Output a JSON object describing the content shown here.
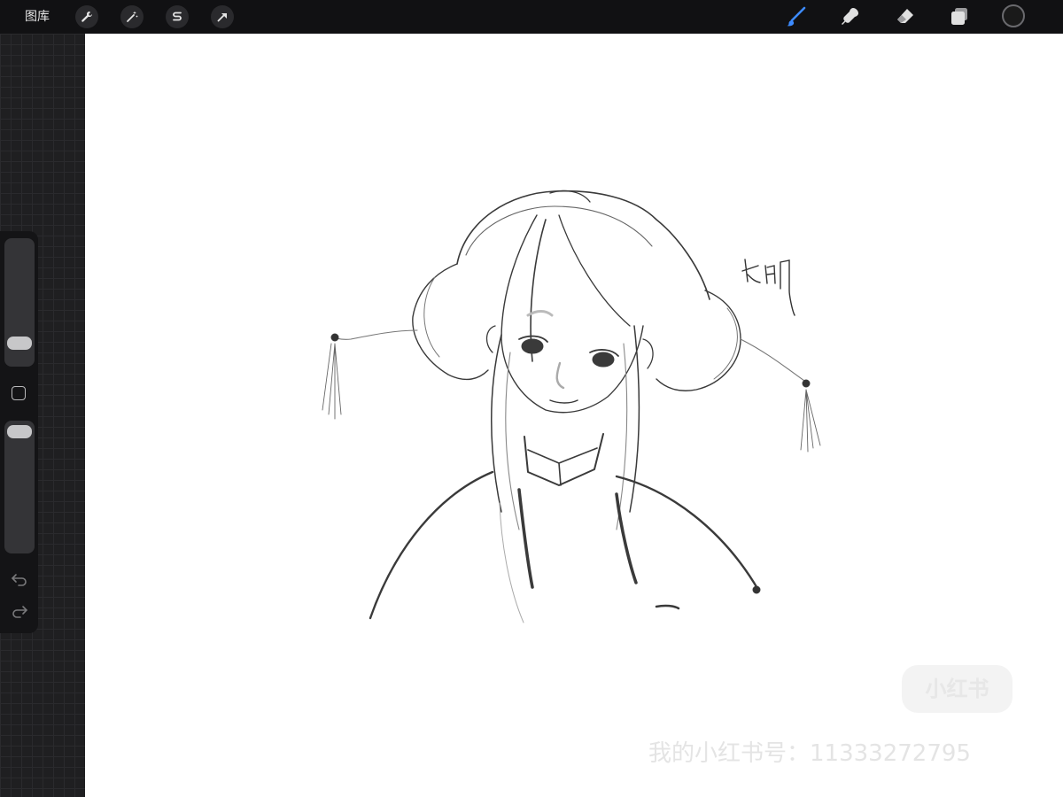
{
  "toolbar": {
    "gallery_label": "图库",
    "left_tools": [
      {
        "icon": "wrench-icon"
      },
      {
        "icon": "magic-wand-icon"
      },
      {
        "icon": "selection-icon"
      },
      {
        "icon": "transform-arrow-icon"
      }
    ],
    "right_tools": [
      {
        "icon": "brush-icon",
        "color": "#3d8bff"
      },
      {
        "icon": "smudge-icon",
        "color": "#e0e0e0"
      },
      {
        "icon": "eraser-icon",
        "color": "#e0e0e0"
      },
      {
        "icon": "layers-icon",
        "color": "#e0e0e0"
      }
    ],
    "current_color": "#1a1a1a"
  },
  "sidebar": {
    "brush_size_level": 0.9,
    "opacity_level": 1.0,
    "undo_icon": "undo-icon",
    "redo_icon": "redo-icon"
  },
  "canvas": {
    "signature_text": "长明",
    "watermark_logo": "小红书",
    "watermark_text": "我的小红书号：1133327279​5"
  }
}
